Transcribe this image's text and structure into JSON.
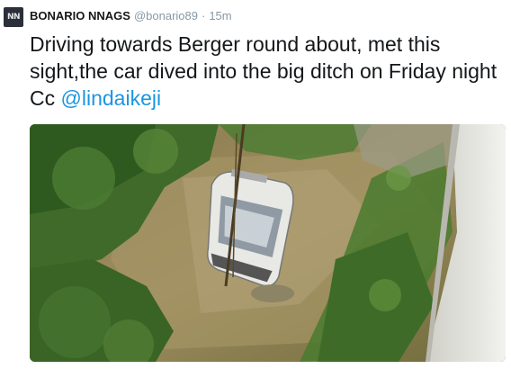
{
  "tweet": {
    "avatar_text": "NN",
    "name": "BONARIO NNAGS",
    "handle": "@bonario89",
    "separator": "·",
    "time": "15m",
    "text": "Driving towards Berger round about, met this sight,the car dived into the big ditch on Friday night Cc",
    "mention": "@lindaikeji"
  },
  "colors": {
    "link": "#1b95e0",
    "text": "#14171a",
    "secondary": "#8899a6"
  }
}
